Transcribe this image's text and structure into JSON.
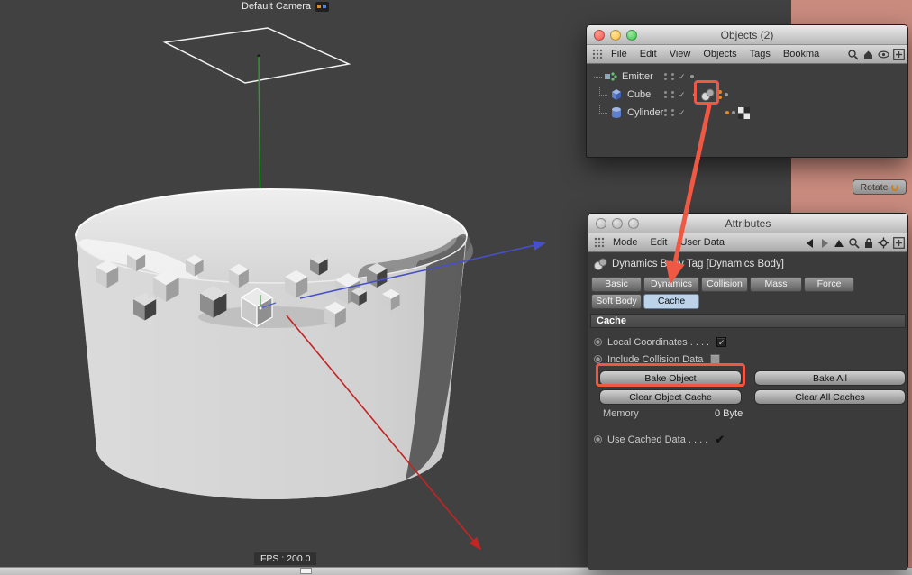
{
  "viewport": {
    "camera_label": "Default Camera",
    "fps_label": "FPS : 200.0",
    "rotate_label": "Rotate"
  },
  "objects_panel": {
    "title": "Objects (2)",
    "menu": {
      "file": "File",
      "edit": "Edit",
      "view": "View",
      "objects": "Objects",
      "tags": "Tags",
      "bookmarks": "Bookma"
    },
    "rows": [
      {
        "label": "Emitter"
      },
      {
        "label": "Cube"
      },
      {
        "label": "Cylinder"
      }
    ]
  },
  "attributes_panel": {
    "title": "Attributes",
    "menu": {
      "mode": "Mode",
      "edit": "Edit",
      "user_data": "User Data"
    },
    "tag_header": "Dynamics Body Tag [Dynamics Body]",
    "tabs_row1": [
      "Basic",
      "Dynamics",
      "Collision",
      "Mass",
      "Force"
    ],
    "tabs_row2": [
      "Soft Body",
      "Cache"
    ],
    "section_title": "Cache",
    "rows": {
      "local_coordinates": "Local Coordinates . . . .",
      "include_collision_data": "Include Collision Data",
      "memory_label": "Memory",
      "memory_value": "0 Byte",
      "use_cached_data": "Use Cached Data . . . ."
    },
    "buttons": {
      "bake_object": "Bake Object",
      "bake_all": "Bake All",
      "clear_object_cache": "Clear Object Cache",
      "clear_all_caches": "Clear All Caches"
    },
    "checks": {
      "local_coordinates": "✓",
      "use_cached_data": "✔"
    }
  },
  "states": {
    "selected_tab": "Cache",
    "local_coordinates_checked": true,
    "include_collision_data_checked": false,
    "use_cached_data_checked": true
  },
  "colors": {
    "annotation_red": "#ef5843",
    "selected_tab_bg": "#bdd3ea",
    "desktop_strip": "#c98b7e",
    "viewport_bg": "#414141"
  },
  "icons": {
    "search-icon": "magnifier",
    "home-icon": "house",
    "eye-icon": "eye",
    "add-icon": "plus-box",
    "lock-icon": "padlock",
    "gear-icon": "gear",
    "back-icon": "left-triangle",
    "forward-icon": "right-triangle",
    "up-icon": "up-triangle",
    "grid-icon": "drag-dots",
    "rotate-icon": "orange-circular-arrow"
  }
}
